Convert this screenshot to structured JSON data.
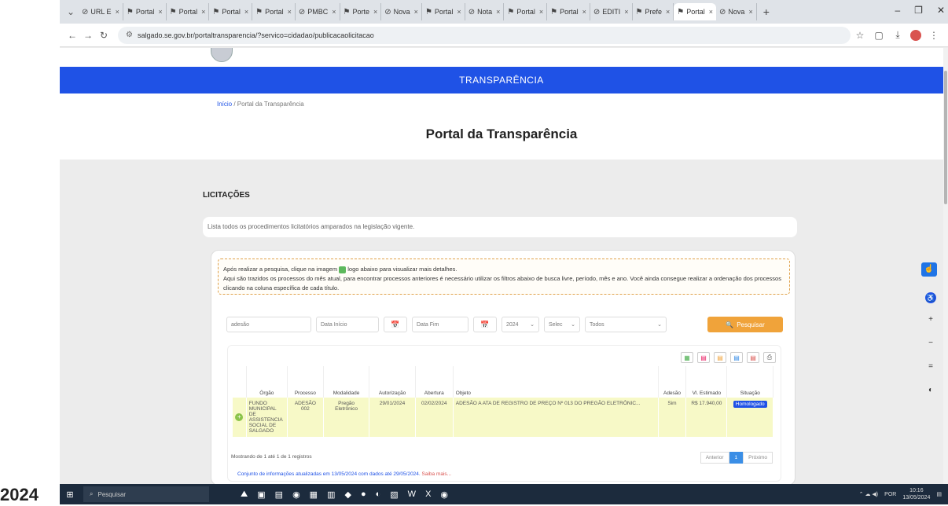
{
  "year_label": "2024",
  "browser": {
    "tabs": [
      {
        "label": "URL E",
        "icon": "globe-icon"
      },
      {
        "label": "Portal",
        "icon": "portal-icon"
      },
      {
        "label": "Portal",
        "icon": "portal-icon"
      },
      {
        "label": "Portal",
        "icon": "portal-icon"
      },
      {
        "label": "Portal",
        "icon": "portal-icon"
      },
      {
        "label": "PMBC",
        "icon": "globe-icon"
      },
      {
        "label": "Porte",
        "icon": "portal-icon"
      },
      {
        "label": "Nova",
        "icon": "globe-icon"
      },
      {
        "label": "Portal",
        "icon": "portal-icon"
      },
      {
        "label": "Nota",
        "icon": "globe-icon"
      },
      {
        "label": "Portal",
        "icon": "portal-icon"
      },
      {
        "label": "Portal",
        "icon": "portal-icon"
      },
      {
        "label": "EDITI",
        "icon": "globe-icon"
      },
      {
        "label": "Prefe",
        "icon": "portal-icon"
      },
      {
        "label": "Portal",
        "icon": "portal-icon",
        "active": true
      },
      {
        "label": "Nova",
        "icon": "globe-icon"
      }
    ],
    "url": "salgado.se.gov.br/portaltransparencia/?servico=cidadao/publicacaolicitacao"
  },
  "header": {
    "banner": "TRANSPARÊNCIA",
    "breadcrumb_home": "Início",
    "breadcrumb_current": " / Portal da Transparência",
    "title": "Portal da Transparência"
  },
  "licitacoes": {
    "heading": "LICITAÇÕES",
    "description": "Lista todos os procedimentos licitatórios amparados na legislação vigente.",
    "notice_line1a": "Após realizar a pesquisa, clique na imagem ",
    "notice_line1b": " logo abaixo para visualizar mais detalhes.",
    "notice_line2": "Aqui são trazidos os processos do mês atual, para encontrar processos anteriores é necessário utilizar os filtros abaixo de busca livre, período, mês e ano. Você ainda consegue realizar a ordenação dos processos clicando na coluna específica de cada título."
  },
  "filters": {
    "search_value": "adesão",
    "date_start_placeholder": "Data Início",
    "date_end_placeholder": "Data Fim",
    "year": "2024",
    "month": "Selec",
    "status": "Todos",
    "search_button": "Pesquisar"
  },
  "table": {
    "headers": [
      "",
      "Órgão",
      "Processo",
      "Modalidade",
      "Autorização",
      "Abertura",
      "Objeto",
      "Adesão",
      "Vl. Estimado",
      "Situação"
    ],
    "rows": [
      {
        "orgao": "FUNDO MUNICIPAL DE ASSISTENCIA SOCIAL DE SALGADO",
        "processo": "ADESÃO 002",
        "modalidade": "Pregão Eletrônico",
        "autorizacao": "29/01/2024",
        "abertura": "02/02/2024",
        "objeto": "ADESÃO A ATA DE REGISTRO DE PREÇO Nº 013 DO PREGÃO ELETRÔNIC...",
        "adesao": "Sim",
        "valor": "R$ 17.940,00",
        "situacao": "Homologado"
      }
    ],
    "showing": "Mostrando de 1 até 1 de 1 registros",
    "prev": "Anterior",
    "page": "1",
    "next": "Próximo",
    "updated_text": "Conjunto de informações atualizadas em 13/05/2024 com dados até 29/05/2024. ",
    "saiba_mais": "Saiba mais..."
  },
  "taskbar": {
    "search_placeholder": "Pesquisar",
    "lang": "POR",
    "time": "10:16",
    "date": "13/05/2024"
  },
  "colors": {
    "banner": "#1f52e6",
    "search_button": "#f0a33a",
    "row_highlight": "#f7f9c7",
    "status_badge": "#1f52e6"
  }
}
